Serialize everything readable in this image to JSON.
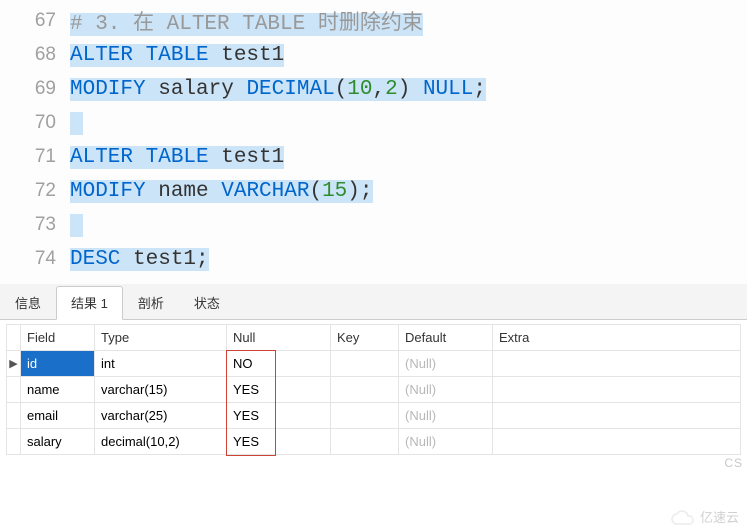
{
  "editor": {
    "lines": [
      {
        "num": 67,
        "tokens": [
          {
            "cls": "c-comment hl",
            "t": "# 3. 在 ALTER TABLE 时删除约束"
          }
        ]
      },
      {
        "num": 68,
        "tokens": [
          {
            "cls": "c-kw hl",
            "t": "ALTER TABLE"
          },
          {
            "cls": "c-ident hl",
            "t": " test1"
          }
        ]
      },
      {
        "num": 69,
        "tokens": [
          {
            "cls": "c-kw hl",
            "t": "MODIFY"
          },
          {
            "cls": "c-ident hl",
            "t": " salary "
          },
          {
            "cls": "c-type hl",
            "t": "DECIMAL"
          },
          {
            "cls": "c-punct hl",
            "t": "("
          },
          {
            "cls": "c-num hl",
            "t": "10"
          },
          {
            "cls": "c-punct hl",
            "t": ","
          },
          {
            "cls": "c-num hl",
            "t": "2"
          },
          {
            "cls": "c-punct hl",
            "t": ") "
          },
          {
            "cls": "c-null hl",
            "t": "NULL"
          },
          {
            "cls": "c-punct hl",
            "t": ";"
          }
        ]
      },
      {
        "num": 70,
        "tokens": [
          {
            "cls": "hl",
            "t": " "
          }
        ]
      },
      {
        "num": 71,
        "tokens": [
          {
            "cls": "c-kw hl",
            "t": "ALTER TABLE"
          },
          {
            "cls": "c-ident hl",
            "t": " test1"
          }
        ]
      },
      {
        "num": 72,
        "tokens": [
          {
            "cls": "c-kw hl",
            "t": "MODIFY"
          },
          {
            "cls": "c-ident hl",
            "t": " name "
          },
          {
            "cls": "c-type hl",
            "t": "VARCHAR"
          },
          {
            "cls": "c-punct hl",
            "t": "("
          },
          {
            "cls": "c-num hl",
            "t": "15"
          },
          {
            "cls": "c-punct hl",
            "t": ");"
          }
        ]
      },
      {
        "num": 73,
        "tokens": [
          {
            "cls": "hl",
            "t": " "
          }
        ]
      },
      {
        "num": 74,
        "tokens": [
          {
            "cls": "c-kw hl",
            "t": "DESC"
          },
          {
            "cls": "c-ident hl",
            "t": " test1"
          },
          {
            "cls": "c-punct hl",
            "t": ";"
          }
        ]
      }
    ]
  },
  "tabs": {
    "items": [
      {
        "label": "信息",
        "active": false
      },
      {
        "label": "结果 1",
        "active": true
      },
      {
        "label": "剖析",
        "active": false
      },
      {
        "label": "状态",
        "active": false
      }
    ]
  },
  "table": {
    "headers": [
      "Field",
      "Type",
      "Null",
      "Key",
      "Default",
      "Extra"
    ],
    "rows": [
      {
        "ptr": "▶",
        "field": "id",
        "selected": true,
        "type": "int",
        "null": "NO",
        "key": "",
        "default": "(Null)",
        "extra": ""
      },
      {
        "ptr": "",
        "field": "name",
        "selected": false,
        "type": "varchar(15)",
        "null": "YES",
        "key": "",
        "default": "(Null)",
        "extra": ""
      },
      {
        "ptr": "",
        "field": "email",
        "selected": false,
        "type": "varchar(25)",
        "null": "YES",
        "key": "",
        "default": "(Null)",
        "extra": ""
      },
      {
        "ptr": "",
        "field": "salary",
        "selected": false,
        "type": "decimal(10,2)",
        "null": "YES",
        "key": "",
        "default": "(Null)",
        "extra": ""
      }
    ]
  },
  "watermark": {
    "text": "亿速云"
  },
  "csmark": {
    "text": "CS"
  }
}
